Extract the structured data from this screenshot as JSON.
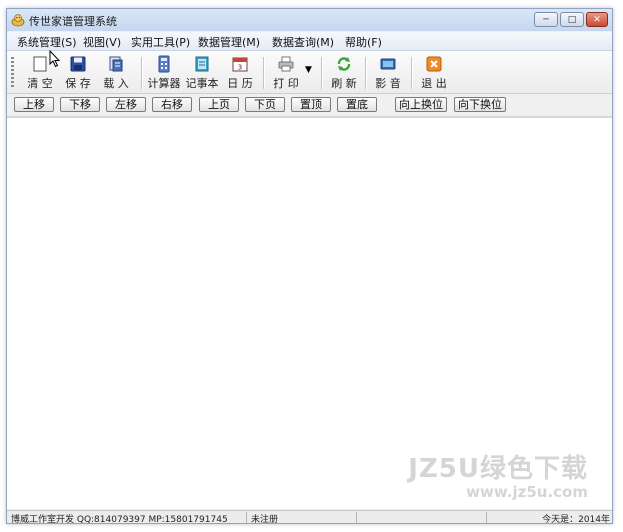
{
  "window": {
    "title": "传世家谱管理系统"
  },
  "menubar": {
    "items": [
      {
        "label": "系统管理(S)"
      },
      {
        "label": "视图(V)"
      },
      {
        "label": "实用工具(P)"
      },
      {
        "label": "数据管理(M)"
      },
      {
        "label": "数据查询(M)"
      },
      {
        "label": "帮助(F)"
      }
    ]
  },
  "toolbar": {
    "clear": "清 空",
    "save": "保 存",
    "load": "载 入",
    "calculator": "计算器",
    "notepad": "记事本",
    "calendar": "日 历",
    "print": "打 印",
    "refresh": "刷 新",
    "media": "影 音",
    "exit": "退 出"
  },
  "navbar": {
    "move_up": "上移",
    "move_down": "下移",
    "move_left": "左移",
    "move_right": "右移",
    "page_up": "上页",
    "page_down": "下页",
    "top": "置顶",
    "bottom": "置底",
    "swap_up": "向上换位",
    "swap_down": "向下换位"
  },
  "statusbar": {
    "developer": "博威工作室开发  QQ:814079397  MP:15801791745",
    "registration": "未注册",
    "date": "今天是：2014年"
  },
  "watermark": {
    "line1": "JZ5U绿色下载",
    "line2": "www.jz5u.com"
  },
  "colors": {
    "title_gradient_top": "#dbe7f7",
    "close_button": "#c94a34",
    "watermark": "#d5d5d5"
  }
}
